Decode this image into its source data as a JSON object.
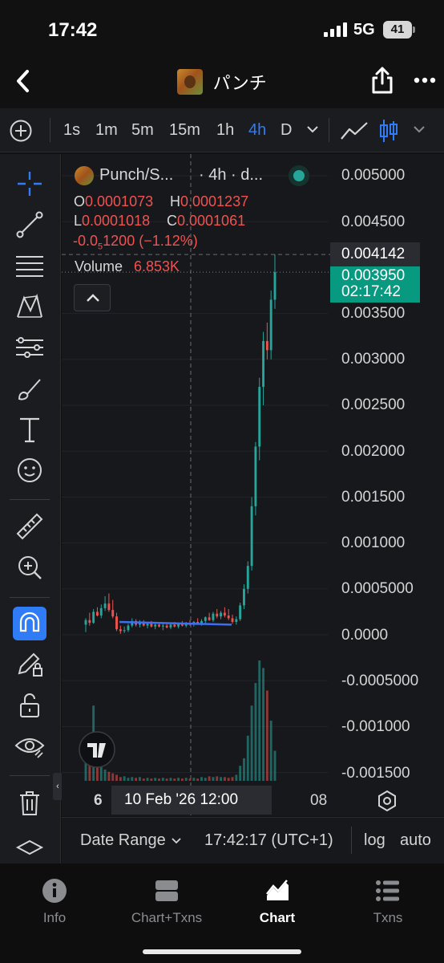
{
  "status_bar": {
    "time": "17:42",
    "network": "5G",
    "battery": "41"
  },
  "nav": {
    "title": "パンチ"
  },
  "toolbar": {
    "intervals": [
      "1s",
      "1m",
      "5m",
      "15m",
      "1h",
      "4h",
      "D"
    ],
    "active_interval": "4h"
  },
  "legend": {
    "symbol": "Punch/S...",
    "interval_text": "· 4h · d...",
    "open_key": "O",
    "open": "0.0001073",
    "high_key": "H",
    "high": "0.0001237",
    "low_key": "L",
    "low": "0.0001018",
    "close_key": "C",
    "close": "0.0001061",
    "change_prefix": "-0.0",
    "change_sub": "5",
    "change_suffix": "1200 (−1.12%)",
    "volume_label": "Volume",
    "volume_value": "6.853K"
  },
  "price_axis": {
    "ticks": [
      "0.005000",
      "0.004500",
      "0.003500",
      "0.003000",
      "0.002500",
      "0.002000",
      "0.001500",
      "0.001000",
      "0.0005000",
      "0.0000",
      "-0.0005000",
      "-0.001000",
      "-0.001500"
    ],
    "crosshair_price": "0.004142",
    "last_price": "0.003950",
    "countdown": "02:17:42"
  },
  "time_axis": {
    "first_label": "6",
    "crosshair_label": "10 Feb '26   12:00",
    "last_label": "08"
  },
  "bottom_bar": {
    "date_range": "Date Range",
    "clock": "17:42:17 (UTC+1)",
    "log": "log",
    "auto": "auto"
  },
  "tabs": [
    {
      "label": "Info",
      "icon": "info-icon"
    },
    {
      "label": "Chart+Txns",
      "icon": "split-view-icon"
    },
    {
      "label": "Chart",
      "icon": "chart-icon"
    },
    {
      "label": "Txns",
      "icon": "list-icon"
    }
  ],
  "active_tab": "Chart",
  "colors": {
    "up": "#26a69a",
    "down": "#ef5350",
    "accent": "#2f7cf6",
    "drawing_line": "#3d6ff0"
  },
  "chart_data": {
    "type": "candlestick",
    "symbol": "Punch/S...",
    "interval": "4h",
    "ylim": [
      -0.0016,
      0.0052
    ],
    "y_ticks": [
      0.005,
      0.0045,
      0.0035,
      0.003,
      0.0025,
      0.002,
      0.0015,
      0.001,
      0.0005,
      0.0,
      -0.0005,
      -0.001,
      -0.0015
    ],
    "crosshair_price": 0.004142,
    "last_price": 0.00395,
    "candles": [
      {
        "o": 0.00011,
        "h": 0.00018,
        "l": 3e-05,
        "c": 0.00016
      },
      {
        "o": 0.00016,
        "h": 0.00024,
        "l": 0.0001,
        "c": 0.00013
      },
      {
        "o": 0.00013,
        "h": 0.00028,
        "l": 0.00012,
        "c": 0.00025
      },
      {
        "o": 0.00025,
        "h": 0.0003,
        "l": 0.0002,
        "c": 0.00021
      },
      {
        "o": 0.00021,
        "h": 0.00033,
        "l": 0.00018,
        "c": 0.00029
      },
      {
        "o": 0.00029,
        "h": 0.00042,
        "l": 0.00026,
        "c": 0.00034
      },
      {
        "o": 0.00034,
        "h": 0.00045,
        "l": 0.00025,
        "c": 0.00027
      },
      {
        "o": 0.00027,
        "h": 0.00038,
        "l": 0.00018,
        "c": 0.0002
      },
      {
        "o": 0.0002,
        "h": 0.00024,
        "l": 4e-05,
        "c": 6e-05
      },
      {
        "o": 6e-05,
        "h": 0.0001,
        "l": 1e-05,
        "c": 4e-05
      },
      {
        "o": 4e-05,
        "h": 9e-05,
        "l": 2e-05,
        "c": 5e-05
      },
      {
        "o": 5e-05,
        "h": 0.00012,
        "l": 3e-05,
        "c": 0.0001
      },
      {
        "o": 0.0001,
        "h": 0.00018,
        "l": 8e-05,
        "c": 0.00015
      },
      {
        "o": 0.00015,
        "h": 0.00017,
        "l": 9e-05,
        "c": 0.00011
      },
      {
        "o": 0.00011,
        "h": 0.00016,
        "l": 8e-05,
        "c": 0.00014
      },
      {
        "o": 0.00014,
        "h": 0.00016,
        "l": 9e-05,
        "c": 0.0001
      },
      {
        "o": 0.0001,
        "h": 0.00014,
        "l": 7e-05,
        "c": 0.00012
      },
      {
        "o": 0.00012,
        "h": 0.00015,
        "l": 8e-05,
        "c": 9e-05
      },
      {
        "o": 9e-05,
        "h": 0.00013,
        "l": 6e-05,
        "c": 0.00011
      },
      {
        "o": 0.00011,
        "h": 0.00014,
        "l": 8e-05,
        "c": 9e-05
      },
      {
        "o": 9e-05,
        "h": 0.00012,
        "l": 5e-05,
        "c": 0.0001
      },
      {
        "o": 0.0001,
        "h": 0.00013,
        "l": 7e-05,
        "c": 8e-05
      },
      {
        "o": 8e-05,
        "h": 0.00012,
        "l": 6e-05,
        "c": 0.00011
      },
      {
        "o": 0.00011,
        "h": 0.00014,
        "l": 8e-05,
        "c": 9e-05
      },
      {
        "o": 9e-05,
        "h": 0.00013,
        "l": 7e-05,
        "c": 0.00012
      },
      {
        "o": 0.00012,
        "h": 0.00015,
        "l": 9e-05,
        "c": 0.0001
      },
      {
        "o": 0.0001,
        "h": 0.00014,
        "l": 8e-05,
        "c": 0.00013
      },
      {
        "o": 0.00013,
        "h": 0.00016,
        "l": 0.0001,
        "c": 0.00011
      },
      {
        "o": 0.00011,
        "h": 0.00015,
        "l": 9e-05,
        "c": 0.00014
      },
      {
        "o": 0.00014,
        "h": 0.00018,
        "l": 0.00011,
        "c": 0.00012
      },
      {
        "o": 0.00012,
        "h": 0.00017,
        "l": 0.0001,
        "c": 0.00015
      },
      {
        "o": 0.00015,
        "h": 0.0002,
        "l": 0.00012,
        "c": 0.00019
      },
      {
        "o": 0.00019,
        "h": 0.00024,
        "l": 0.00015,
        "c": 0.00016
      },
      {
        "o": 0.00016,
        "h": 0.00025,
        "l": 0.00014,
        "c": 0.00023
      },
      {
        "o": 0.00023,
        "h": 0.00028,
        "l": 0.00018,
        "c": 0.0002
      },
      {
        "o": 0.0002,
        "h": 0.00026,
        "l": 0.00017,
        "c": 0.00024
      },
      {
        "o": 0.00024,
        "h": 0.0003,
        "l": 0.00019,
        "c": 0.00021
      },
      {
        "o": 0.00021,
        "h": 0.00028,
        "l": 0.00016,
        "c": 0.00018
      },
      {
        "o": 0.00018,
        "h": 0.00022,
        "l": 0.00012,
        "c": 0.00014
      },
      {
        "o": 0.00014,
        "h": 0.0002,
        "l": 0.00011,
        "c": 0.00017
      },
      {
        "o": 0.00017,
        "h": 0.00035,
        "l": 0.00015,
        "c": 0.00032
      },
      {
        "o": 0.00032,
        "h": 0.00055,
        "l": 0.00028,
        "c": 0.0005
      },
      {
        "o": 0.0005,
        "h": 0.0008,
        "l": 0.00045,
        "c": 0.00075
      },
      {
        "o": 0.00075,
        "h": 0.0015,
        "l": 0.0007,
        "c": 0.0014
      },
      {
        "o": 0.0014,
        "h": 0.0021,
        "l": 0.0013,
        "c": 0.00205
      },
      {
        "o": 0.00205,
        "h": 0.0028,
        "l": 0.0019,
        "c": 0.0027
      },
      {
        "o": 0.0027,
        "h": 0.0033,
        "l": 0.0025,
        "c": 0.0032
      },
      {
        "o": 0.0032,
        "h": 0.0034,
        "l": 0.003,
        "c": 0.0031
      },
      {
        "o": 0.0031,
        "h": 0.00375,
        "l": 0.003,
        "c": 0.00365
      },
      {
        "o": 0.00365,
        "h": 0.004142,
        "l": 0.00355,
        "c": 0.00395
      }
    ],
    "volumes": [
      0.4,
      0.6,
      1.0,
      0.3,
      0.2,
      0.15,
      0.12,
      0.1,
      0.08,
      0.05,
      0.06,
      0.04,
      0.05,
      0.04,
      0.05,
      0.03,
      0.04,
      0.03,
      0.04,
      0.03,
      0.04,
      0.03,
      0.04,
      0.03,
      0.04,
      0.03,
      0.04,
      0.03,
      0.04,
      0.03,
      0.05,
      0.04,
      0.06,
      0.05,
      0.06,
      0.05,
      0.05,
      0.04,
      0.05,
      0.08,
      0.2,
      0.3,
      0.6,
      1.0,
      1.3,
      1.6,
      1.5,
      1.2,
      0.8,
      0.4
    ]
  }
}
